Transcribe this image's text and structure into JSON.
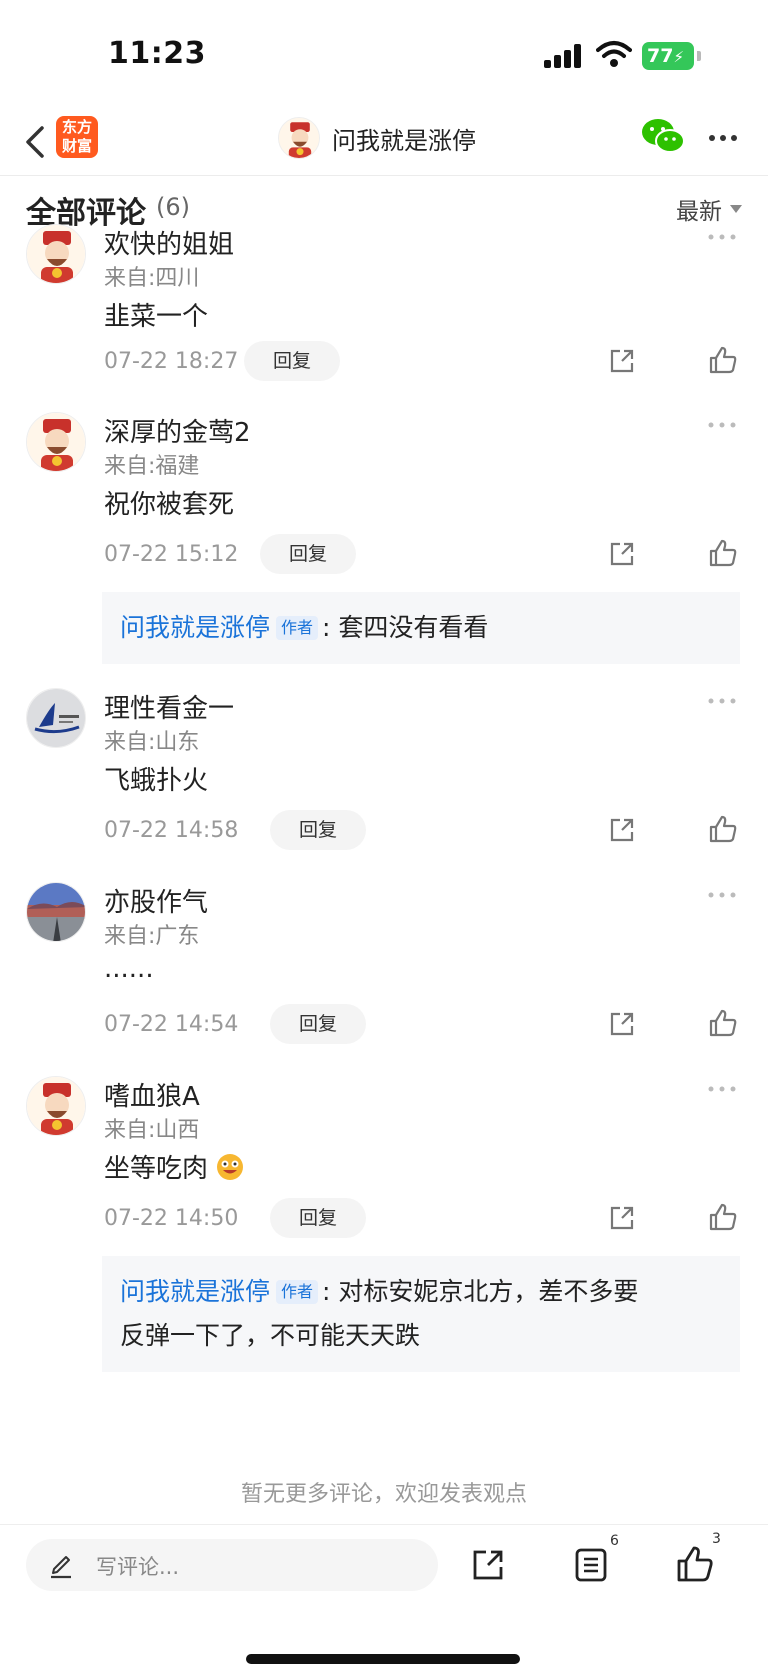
{
  "status_bar": {
    "time": "11:23",
    "battery": "77"
  },
  "nav": {
    "logo_line1": "东方",
    "logo_line2": "财富",
    "title": "问我就是涨停"
  },
  "section": {
    "title": "全部评论",
    "count": "(6)",
    "sort": "最新"
  },
  "comments": [
    {
      "name": "欢快的姐姐",
      "location": "来自:四川",
      "text": "韭菜一个",
      "time": "07-22 18:27",
      "reply_label": "回复",
      "avatar": "fortune-god-avatar"
    },
    {
      "name": "深厚的金莺2",
      "location": "来自:福建",
      "text": "祝你被套死",
      "time": "07-22 15:12",
      "reply_label": "回复",
      "avatar": "fortune-god-avatar",
      "author_reply": {
        "name": "问我就是涨停",
        "badge": "作者",
        "sep": ":",
        "text": "套四没有看看"
      }
    },
    {
      "name": "理性看金一",
      "location": "来自:山东",
      "text": "飞蛾扑火",
      "time": "07-22 14:58",
      "reply_label": "回复",
      "avatar": "kayak-logo-avatar"
    },
    {
      "name": "亦股作气",
      "location": "来自:广东",
      "text": "......",
      "time": "07-22 14:54",
      "reply_label": "回复",
      "avatar": "landscape-avatar"
    },
    {
      "name": "嗜血狼A",
      "location": "来自:山西",
      "text": "坐等吃肉",
      "time": "07-22 14:50",
      "reply_label": "回复",
      "avatar": "fortune-god-avatar",
      "author_reply": {
        "name": "问我就是涨停",
        "badge": "作者",
        "sep": ":",
        "text": "对标安妮京北方，差不多要",
        "text_line2": "反弹一下了，不可能天天跌"
      }
    }
  ],
  "end_note": "暂无更多评论，欢迎发表观点",
  "bottom_bar": {
    "placeholder": "写评论...",
    "list_count": "6",
    "like_count": "3"
  },
  "colors": {
    "accent_blue": "#1a73d9",
    "brand_orange": "#ff5a1f",
    "battery_green": "#34c759",
    "wechat_green": "#2dc100"
  }
}
